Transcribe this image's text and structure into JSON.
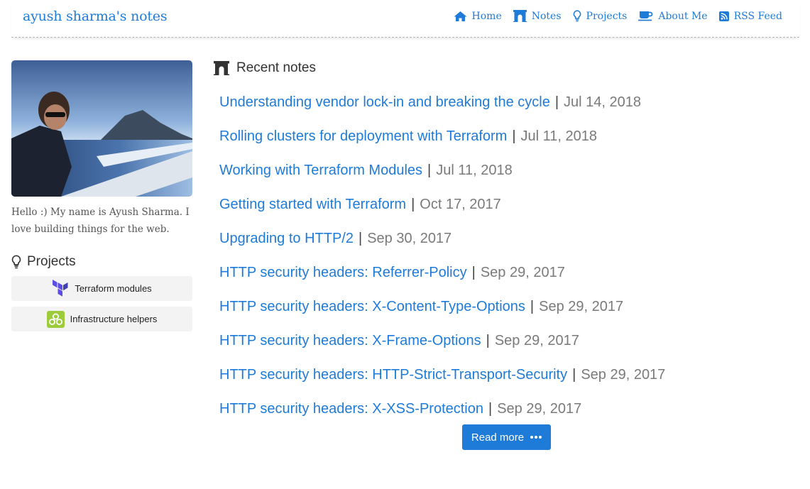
{
  "header": {
    "site_title": "ayush sharma's notes",
    "nav": [
      {
        "label": "Home",
        "icon": "home-icon"
      },
      {
        "label": "Notes",
        "icon": "archway-icon"
      },
      {
        "label": "Projects",
        "icon": "lightbulb-icon"
      },
      {
        "label": "About Me",
        "icon": "coffee-icon"
      },
      {
        "label": "RSS Feed",
        "icon": "rss-icon"
      }
    ]
  },
  "sidebar": {
    "photo": "profile-photo",
    "bio": "Hello :) My name is Ayush Sharma. I love building things for the web.",
    "projects_heading": "Projects",
    "projects": [
      {
        "label": "Terraform modules",
        "icon": "terraform-logo-icon"
      },
      {
        "label": "Infrastructure helpers",
        "icon": "infrastructure-logo-icon"
      }
    ]
  },
  "main": {
    "heading": "Recent notes",
    "notes": [
      {
        "title": "Understanding vendor lock-in and breaking the cycle",
        "date": "Jul 14, 2018"
      },
      {
        "title": "Rolling clusters for deployment with Terraform",
        "date": "Jul 11, 2018"
      },
      {
        "title": "Working with Terraform Modules",
        "date": "Jul 11, 2018"
      },
      {
        "title": "Getting started with Terraform",
        "date": "Oct 17, 2017"
      },
      {
        "title": "Upgrading to HTTP/2",
        "date": "Sep 30, 2017"
      },
      {
        "title": "HTTP security headers: Referrer-Policy",
        "date": "Sep 29, 2017"
      },
      {
        "title": "HTTP security headers: X-Content-Type-Options",
        "date": "Sep 29, 2017"
      },
      {
        "title": "HTTP security headers: X-Frame-Options",
        "date": "Sep 29, 2017"
      },
      {
        "title": "HTTP security headers: HTTP-Strict-Transport-Security",
        "date": "Sep 29, 2017"
      },
      {
        "title": "HTTP security headers: X-XSS-Protection",
        "date": "Sep 29, 2017"
      }
    ],
    "separator": "|",
    "read_more": "Read more"
  },
  "colors": {
    "link": "#1e7bd8",
    "date": "#7a7a7a",
    "button_bg": "#1e7bd8",
    "project_bg": "#f3f3f3"
  }
}
